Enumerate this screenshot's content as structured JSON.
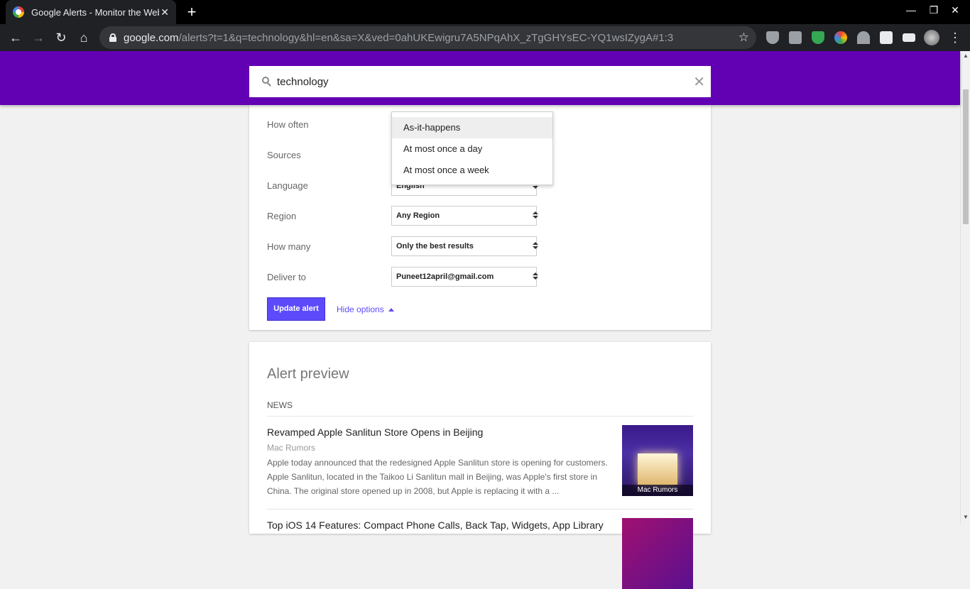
{
  "browser": {
    "tab_title": "Google Alerts - Monitor the Web",
    "tab_close": "✕",
    "new_tab": "+",
    "url_host": "google.com",
    "url_path": "/alerts?t=1&q=technology&hl=en&sa=X&ved=0ahUKEwigru7A5NPqAhX_zTgGHYsEC-YQ1wsIZygA#1:3"
  },
  "search": {
    "query": "technology"
  },
  "options": {
    "how_often_label": "How often",
    "sources_label": "Sources",
    "language_label": "Language",
    "language_value": "English",
    "region_label": "Region",
    "region_value": "Any Region",
    "how_many_label": "How many",
    "how_many_value": "Only the best results",
    "deliver_label": "Deliver to",
    "deliver_value": "Puneet12april@gmail.com",
    "update_button": "Update alert",
    "hide_options": "Hide options"
  },
  "dropdown": {
    "items": [
      "As-it-happens",
      "At most once a day",
      "At most once a week"
    ],
    "selected_index": 0
  },
  "preview": {
    "title": "Alert preview",
    "section": "NEWS",
    "articles": [
      {
        "title": "Revamped Apple Sanlitun Store Opens in Beijing",
        "source": "Mac Rumors",
        "snippet": "Apple today announced that the redesigned Apple Sanlitun store is opening for customers. Apple Sanlitun, located in the Taikoo Li Sanlitun mall in Beijing, was Apple's first store in China. The original store opened up in 2008, but Apple is replacing it with a ...",
        "thumb_caption": "Mac Rumors"
      },
      {
        "title": "Top iOS 14 Features: Compact Phone Calls, Back Tap, Widgets, App Library"
      }
    ]
  },
  "colors": {
    "appbar": "#6200b3",
    "accent": "#5d4bfb"
  }
}
